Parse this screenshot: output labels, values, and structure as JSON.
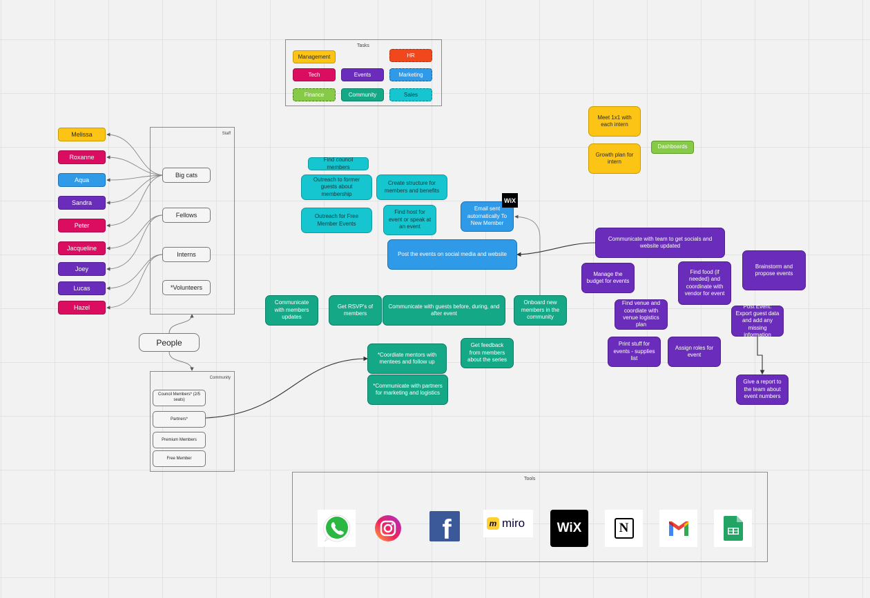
{
  "tasks_legend": {
    "title": "Tasks",
    "items": [
      {
        "label": "Management",
        "color": "#fcc515"
      },
      {
        "label": "HR",
        "color": "#f0471d"
      },
      {
        "label": "Tech",
        "color": "#db0d61"
      },
      {
        "label": "Events",
        "color": "#6a2cba"
      },
      {
        "label": "Marketing",
        "color": "#2e9ae8"
      },
      {
        "label": "Finance",
        "color": "#86ca48"
      },
      {
        "label": "Community",
        "color": "#14a887"
      },
      {
        "label": "Sales",
        "color": "#15c5cf"
      }
    ]
  },
  "staff": {
    "title": "Staff",
    "groups": [
      "Big cats",
      "Fellows",
      "Interns",
      "*Volunteers"
    ],
    "people": [
      "Melissa",
      "Roxanne",
      "Aqua",
      "Sandra",
      "Peter",
      "Jacqueline",
      "Joey",
      "Lucas",
      "Hazel"
    ]
  },
  "people_node": "People",
  "community": {
    "title": "Community",
    "members": [
      "Council Members* (2/5 seats)",
      "Partners*",
      "Premium Members",
      "Free Member"
    ]
  },
  "sales_tasks": [
    "Find council members",
    "Outreach to former guests about membership",
    "Create structure for members and benefits",
    "Outreach for Free Member Events",
    "Find host for event or speak at an event"
  ],
  "marketing_tasks": [
    "Email sent automatically To New Member",
    "Post the events on social media and website"
  ],
  "wix_badge": "WiX",
  "community_tasks": [
    "Communicate with members updates",
    "Get RSVP's of members",
    "Communicate with guests before, during, and after event",
    "Onboard new members in the community",
    "Get feedback from members about the series",
    "*Coordiate mentors with mentees and follow up",
    "*Communicate with partners for marketing and logistics"
  ],
  "management_tasks": [
    "Meet 1x1 with each intern",
    "Growth plan for intern"
  ],
  "finance_tasks": [
    "Dashboards"
  ],
  "event_tasks": [
    "Communicate with team to get socials and website updated",
    "Manage the budget for events",
    "Find food (if needed) and coordinate with vendor for event",
    "Brainstorm and propose events",
    "Find venue and coordiate with venue logistics plan",
    "Post Event: Export guest data and add any missing information",
    "Print stuff for events - supplies list",
    "Assign roles for event",
    "Give a report to the team about event numbers"
  ],
  "tools": {
    "title": "Tools",
    "items": [
      {
        "name": "whatsapp",
        "label": ""
      },
      {
        "name": "instagram",
        "label": ""
      },
      {
        "name": "facebook",
        "label": "f"
      },
      {
        "name": "miro",
        "label": "miro"
      },
      {
        "name": "wix",
        "label": "WiX"
      },
      {
        "name": "notion",
        "label": "N"
      },
      {
        "name": "gmail",
        "label": "M"
      },
      {
        "name": "google-sheets",
        "label": ""
      }
    ]
  }
}
